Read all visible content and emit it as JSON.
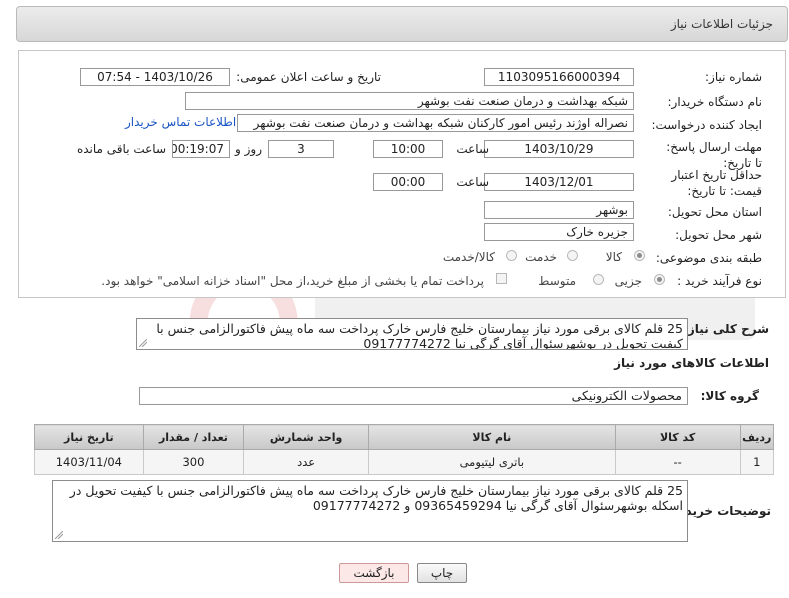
{
  "header": {
    "title": "جزئیات اطلاعات نیاز"
  },
  "form": {
    "need_number_label": "شماره نیاز:",
    "need_number": "1103095166000394",
    "announce_label": "تاریخ و ساعت اعلان عمومی:",
    "announce_value": "1403/10/26 - 07:54",
    "buyer_org_label": "نام دستگاه خریدار:",
    "buyer_org": "شبکه بهداشت و درمان صنعت نفت بوشهر",
    "creator_label": "ایجاد کننده درخواست:",
    "creator": "نصراله اوژند رئیس امور کارکنان شبکه بهداشت و درمان صنعت نفت بوشهر",
    "contact_link": "اطلاعات تماس خریدار",
    "deadline_label": "مهلت ارسال پاسخ: تا تاریخ:",
    "deadline_date": "1403/10/29",
    "time_label": "ساعت",
    "deadline_time": "10:00",
    "days_value": "3",
    "days_label": "روز و",
    "remaining_time": "00:19:07",
    "remaining_label": "ساعت باقی مانده",
    "validity_label": "حداقل تاریخ اعتبار قیمت: تا تاریخ:",
    "validity_date": "1403/12/01",
    "validity_time": "00:00",
    "province_label": "استان محل تحویل:",
    "province": "بوشهر",
    "city_label": "شهر محل تحویل:",
    "city": "جزیره خارک",
    "category_label": "طبقه بندی موضوعی:",
    "category_options": [
      "کالا",
      "خدمت",
      "کالا/خدمت"
    ],
    "category_selected": "کالا",
    "process_label": "نوع فرآیند خرید :",
    "process_options": [
      "جزیی",
      "متوسط"
    ],
    "process_selected": "جزیی",
    "payment_text": "پرداخت تمام یا بخشی از مبلغ خرید،از محل \"اسناد خزانه اسلامی\" خواهد بود."
  },
  "description": {
    "label": "شرح کلی نیاز:",
    "text": "25 قلم کالای برقی مورد نیاز بیمارستان خلیج فارس خارک پرداخت سه ماه پیش فاکتورالزامی جنس با کیفیت تحویل در بوشهرسئوال آقای گرگی نیا 09177774272"
  },
  "goods": {
    "section_title": "اطلاعات کالاهای مورد نیاز",
    "group_label": "گروه کالا:",
    "group_value": "محصولات الکترونیکی",
    "columns": [
      "ردیف",
      "کد کالا",
      "نام کالا",
      "واحد شمارش",
      "تعداد / مقدار",
      "تاریخ نیاز"
    ],
    "rows": [
      {
        "row": "1",
        "code": "--",
        "name": "باتری لیتیومی",
        "unit": "عدد",
        "qty": "300",
        "date": "1403/11/04"
      }
    ]
  },
  "buyer_notes": {
    "label": "توضیحات خریدار:",
    "text": "25 قلم کالای برقی مورد نیاز بیمارستان خلیج فارس خارک پرداخت سه ماه پیش فاکتورالزامی جنس با کیفیت تحویل در اسکله بوشهرسئوال آقای گرگی نیا 09365459294 و 09177774272"
  },
  "buttons": {
    "print": "چاپ",
    "back": "بازگشت"
  },
  "colors": {
    "link": "#1a55c4",
    "back_button": "#fde8e8",
    "header_bg": "#dcdcdc"
  }
}
